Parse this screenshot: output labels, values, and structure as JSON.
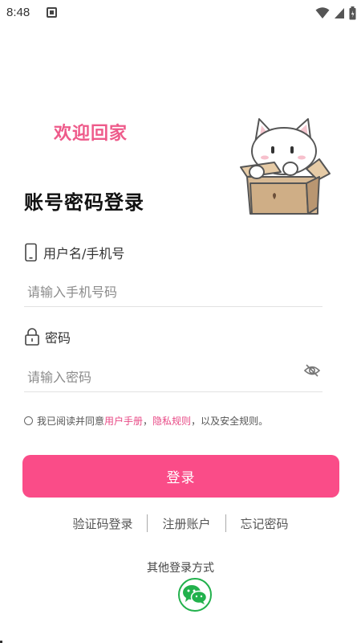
{
  "status_bar": {
    "time": "8:48",
    "icons": [
      "notification-icon",
      "wifi-icon",
      "signal-icon",
      "battery-icon"
    ]
  },
  "header": {
    "welcome": "欢迎回家",
    "title": "账号密码登录"
  },
  "form": {
    "username_label": "用户名/手机号",
    "username_placeholder": "请输入手机号码",
    "username_value": "",
    "password_label": "密码",
    "password_placeholder": "请输入密码",
    "password_value": ""
  },
  "agreement": {
    "prefix": "我已阅读并同意",
    "user_manual": "用户手册",
    "sep": "，",
    "privacy": "隐私规则",
    "suffix": "，以及安全规则。",
    "checked": false
  },
  "login_button": "登录",
  "links": {
    "sms_login": "验证码登录",
    "register": "注册账户",
    "forgot": "忘记密码"
  },
  "other_login": {
    "title": "其他登录方式",
    "methods": [
      "wechat-icon"
    ]
  },
  "colors": {
    "accent": "#fa4c88",
    "welcome": "#ee5a8a",
    "link": "#e84a86",
    "wechat": "#22b14c"
  }
}
